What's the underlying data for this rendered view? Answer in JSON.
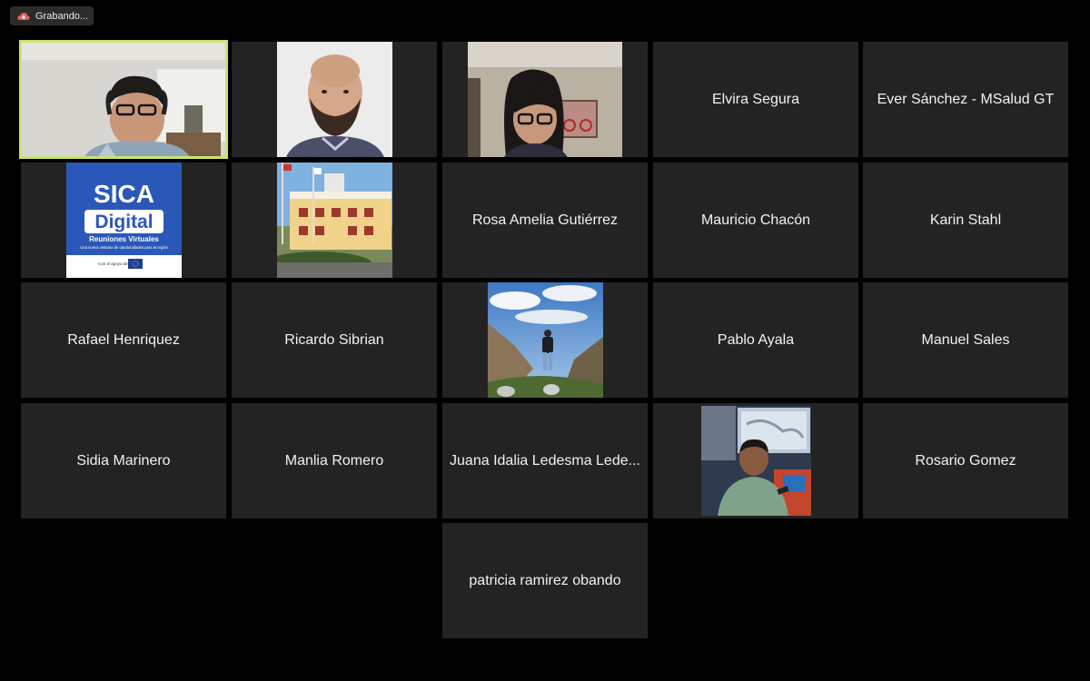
{
  "recording": {
    "label": "Grabando...",
    "icon": "recording-cloud-icon",
    "color": "#e06464"
  },
  "accent": {
    "active_speaker_border": "#c9e46e",
    "tile_bg": "#232323"
  },
  "participants": [
    {
      "name": "",
      "has_video": true,
      "kind": "webcam-man-headset",
      "active": true
    },
    {
      "name": "",
      "has_video": true,
      "kind": "photo-bearded-man"
    },
    {
      "name": "",
      "has_video": true,
      "kind": "webcam-woman-glasses"
    },
    {
      "name": "Elvira Segura",
      "has_video": false
    },
    {
      "name": "Ever Sánchez - MSalud GT",
      "has_video": false
    },
    {
      "name": "",
      "has_video": true,
      "kind": "sica-digital-logo",
      "logo": {
        "line1": "SICA",
        "line2": "Digital",
        "line3": "Reuniones Virtuales",
        "line4": "Una nueva ventana de oportunidades para la región",
        "footer": "Con el apoyo de:"
      }
    },
    {
      "name": "",
      "has_video": true,
      "kind": "photo-building"
    },
    {
      "name": "Rosa Amelia Gutiérrez",
      "has_video": false
    },
    {
      "name": "Mauricio Chacón",
      "has_video": false
    },
    {
      "name": "Karin Stahl",
      "has_video": false
    },
    {
      "name": "Rafael Henriquez",
      "has_video": false
    },
    {
      "name": "Ricardo Sibrian",
      "has_video": false
    },
    {
      "name": "",
      "has_video": true,
      "kind": "photo-mountain-hiker"
    },
    {
      "name": "Pablo Ayala",
      "has_video": false
    },
    {
      "name": "Manuel Sales",
      "has_video": false
    },
    {
      "name": "Sidia Marinero",
      "has_video": false
    },
    {
      "name": "Manlia Romero",
      "has_video": false
    },
    {
      "name": "Juana Idalia Ledesma Lede...",
      "has_video": false
    },
    {
      "name": "",
      "has_video": true,
      "kind": "photo-man-presenting"
    },
    {
      "name": "Rosario Gomez",
      "has_video": false
    },
    {
      "name": "patricia ramirez obando",
      "has_video": false
    }
  ]
}
